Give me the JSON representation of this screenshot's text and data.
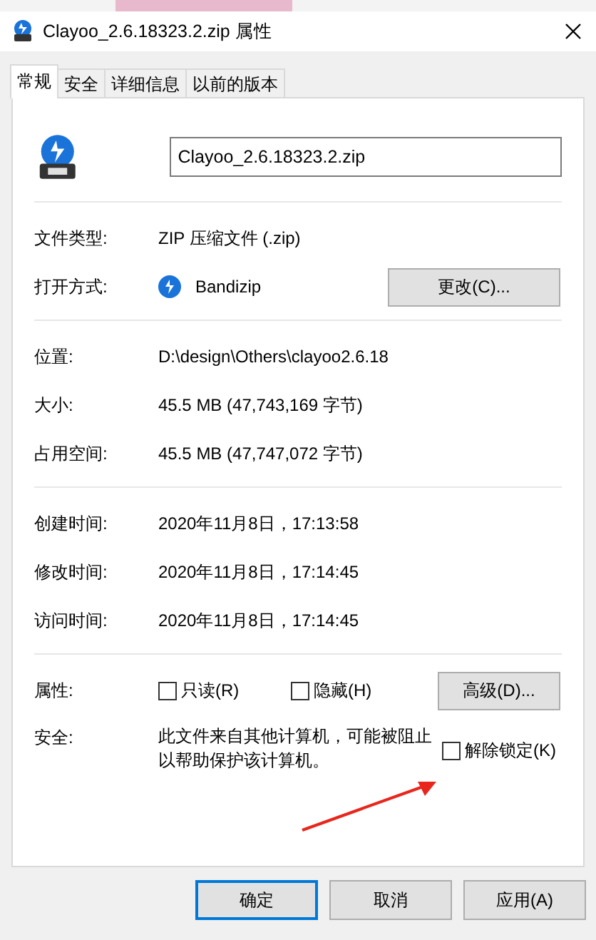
{
  "window": {
    "title": "Clayoo_2.6.18323.2.zip 属性"
  },
  "tabs": [
    {
      "label": "常规",
      "selected": true
    },
    {
      "label": "安全",
      "selected": false
    },
    {
      "label": "详细信息",
      "selected": false
    },
    {
      "label": "以前的版本",
      "selected": false
    }
  ],
  "file_name": "Clayoo_2.6.18323.2.zip",
  "sections": [
    [
      {
        "kind": "text",
        "label": "文件类型:",
        "value": "ZIP 压缩文件 (.zip)"
      },
      {
        "kind": "app",
        "label": "打开方式:",
        "value": "Bandizip",
        "button": "更改(C)..."
      }
    ],
    [
      {
        "kind": "text",
        "label": "位置:",
        "value": "D:\\design\\Others\\clayoo2.6.18"
      },
      {
        "kind": "text",
        "label": "大小:",
        "value": "45.5 MB (47,743,169 字节)"
      },
      {
        "kind": "text",
        "label": "占用空间:",
        "value": "45.5 MB (47,747,072 字节)"
      }
    ],
    [
      {
        "kind": "text",
        "label": "创建时间:",
        "value": "2020年11月8日，17:13:58"
      },
      {
        "kind": "text",
        "label": "修改时间:",
        "value": "2020年11月8日，17:14:45"
      },
      {
        "kind": "text",
        "label": "访问时间:",
        "value": "2020年11月8日，17:14:45"
      }
    ],
    [
      {
        "kind": "attributes",
        "label": "属性:",
        "checkboxes": [
          {
            "label": "只读(R)",
            "checked": false
          },
          {
            "label": "隐藏(H)",
            "checked": false
          }
        ],
        "button": "高级(D)..."
      },
      {
        "kind": "security",
        "label": "安全:",
        "value": "此文件来自其他计算机，可能被阻止以帮助保护该计算机。",
        "checkbox": {
          "label": "解除锁定(K)",
          "checked": false
        }
      }
    ]
  ],
  "buttons": [
    {
      "label": "确定",
      "default": true
    },
    {
      "label": "取消",
      "default": false
    },
    {
      "label": "应用(A)",
      "default": false
    }
  ]
}
